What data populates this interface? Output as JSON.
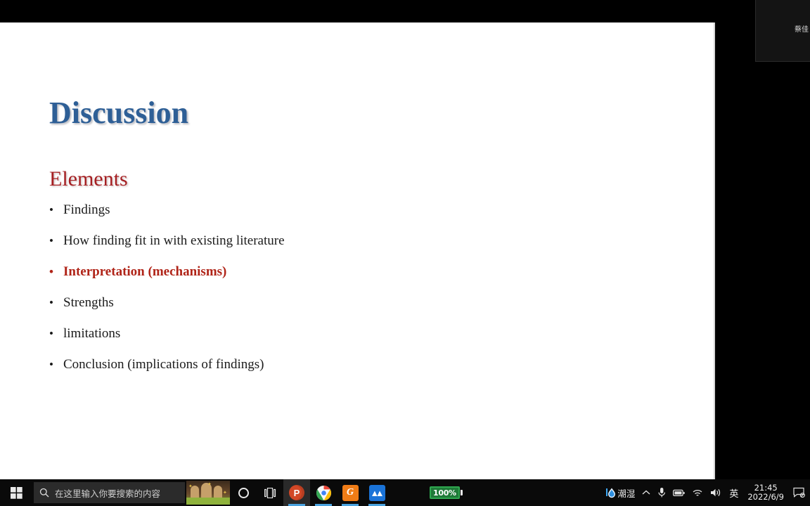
{
  "meeting": {
    "participant_name": "蔡佳"
  },
  "slide": {
    "title": "Discussion",
    "section_heading": "Elements",
    "title_color": "#2e5f96",
    "heading_color": "#a51f22",
    "accent_color": "#b02418",
    "bullet_glyph": "•",
    "bullets": [
      {
        "text": "Findings",
        "accent": false
      },
      {
        "text": "How finding fit in with existing literature",
        "accent": false
      },
      {
        "text": "Interpretation (mechanisms)",
        "accent": true
      },
      {
        "text": "Strengths",
        "accent": false
      },
      {
        "text": "limitations",
        "accent": false
      },
      {
        "text": "Conclusion (implications of findings)",
        "accent": false
      }
    ]
  },
  "taskbar": {
    "start_label": "start-button",
    "search": {
      "placeholder": "在这里输入你要搜索的内容",
      "icon": "search-icon"
    },
    "news_thumbnail_label": "news-and-interests-thumbnail",
    "pinned": [
      {
        "name": "cortana-button",
        "glyph": ""
      },
      {
        "name": "task-view-button",
        "glyph": "⊟"
      },
      {
        "name": "powerpoint-button",
        "glyph": "P",
        "active": true
      },
      {
        "name": "chrome-button",
        "glyph": "",
        "active": true
      },
      {
        "name": "gtja-button",
        "glyph": "G",
        "active": true
      },
      {
        "name": "wps-button",
        "glyph": "",
        "active": true
      }
    ],
    "battery": {
      "percent": "100%",
      "color": "#2fa84f"
    },
    "tray": {
      "weather_text": "潮湿",
      "chevron": "⌃",
      "ime_language": "英",
      "time": "21:45",
      "date": "2022/6/9"
    }
  }
}
